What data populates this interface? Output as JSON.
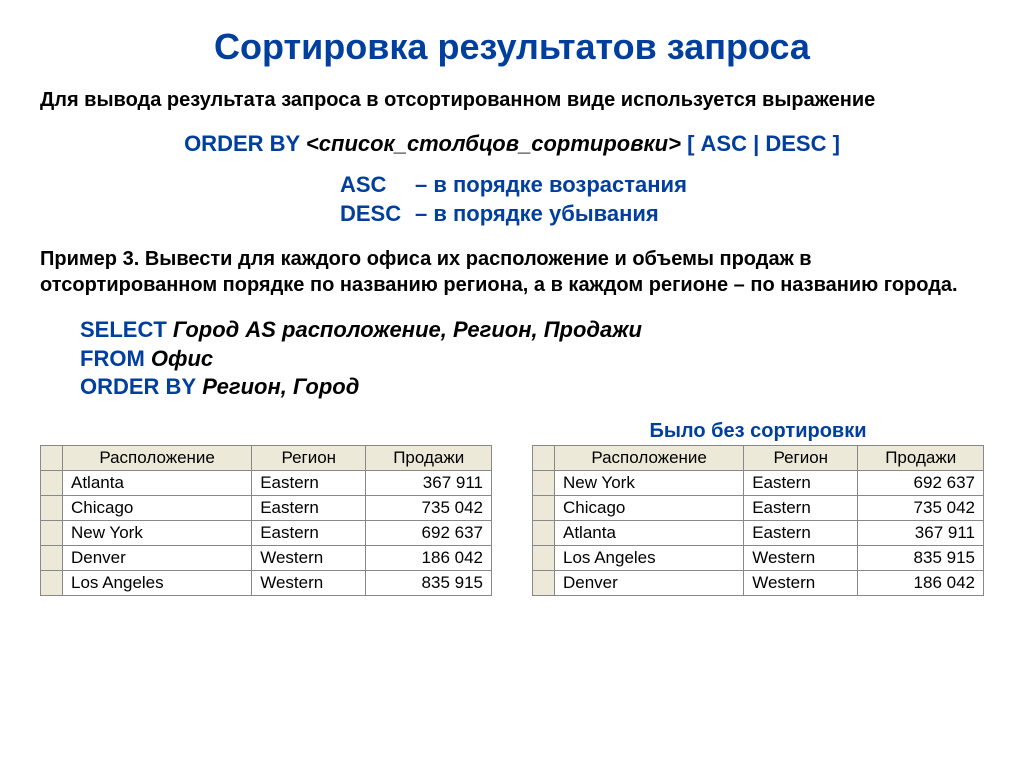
{
  "title": "Сортировка результатов запроса",
  "intro": "Для вывода результата запроса в отсортированном виде используется выражение",
  "syntax": {
    "keyword": "ORDER BY",
    "param": "<список_столбцов_сортировки>",
    "open": "[",
    "opt": "ASC | DESC",
    "close": "]"
  },
  "defs": {
    "asc_term": "ASC",
    "asc_text": "– в порядке возрастания",
    "desc_term": "DESC",
    "desc_text": "– в порядке убывания"
  },
  "example": "Пример 3. Вывести для каждого офиса их расположение и объемы продаж в отсортированном порядке по названию региона, а в каждом регионе – по названию города.",
  "sql": {
    "l1_kw": "SELECT",
    "l1_txt": " Город AS расположение, Регион, Продажи",
    "l2_kw": "FROM",
    "l2_txt": " Офис",
    "l3_kw": "ORDER BY",
    "l3_txt": " Регион, Город"
  },
  "headers": {
    "h1": "Расположение",
    "h2": "Регион",
    "h3": "Продажи"
  },
  "caption_unsorted": "Было без сортировки",
  "sorted": [
    {
      "loc": "Atlanta",
      "reg": "Eastern",
      "sales": "367 911"
    },
    {
      "loc": "Chicago",
      "reg": "Eastern",
      "sales": "735 042"
    },
    {
      "loc": "New York",
      "reg": "Eastern",
      "sales": "692 637"
    },
    {
      "loc": "Denver",
      "reg": "Western",
      "sales": "186 042"
    },
    {
      "loc": "Los Angeles",
      "reg": "Western",
      "sales": "835 915"
    }
  ],
  "unsorted": [
    {
      "loc": "New York",
      "reg": "Eastern",
      "sales": "692 637"
    },
    {
      "loc": "Chicago",
      "reg": "Eastern",
      "sales": "735 042"
    },
    {
      "loc": "Atlanta",
      "reg": "Eastern",
      "sales": "367 911"
    },
    {
      "loc": "Los Angeles",
      "reg": "Western",
      "sales": "835 915"
    },
    {
      "loc": "Denver",
      "reg": "Western",
      "sales": "186 042"
    }
  ]
}
